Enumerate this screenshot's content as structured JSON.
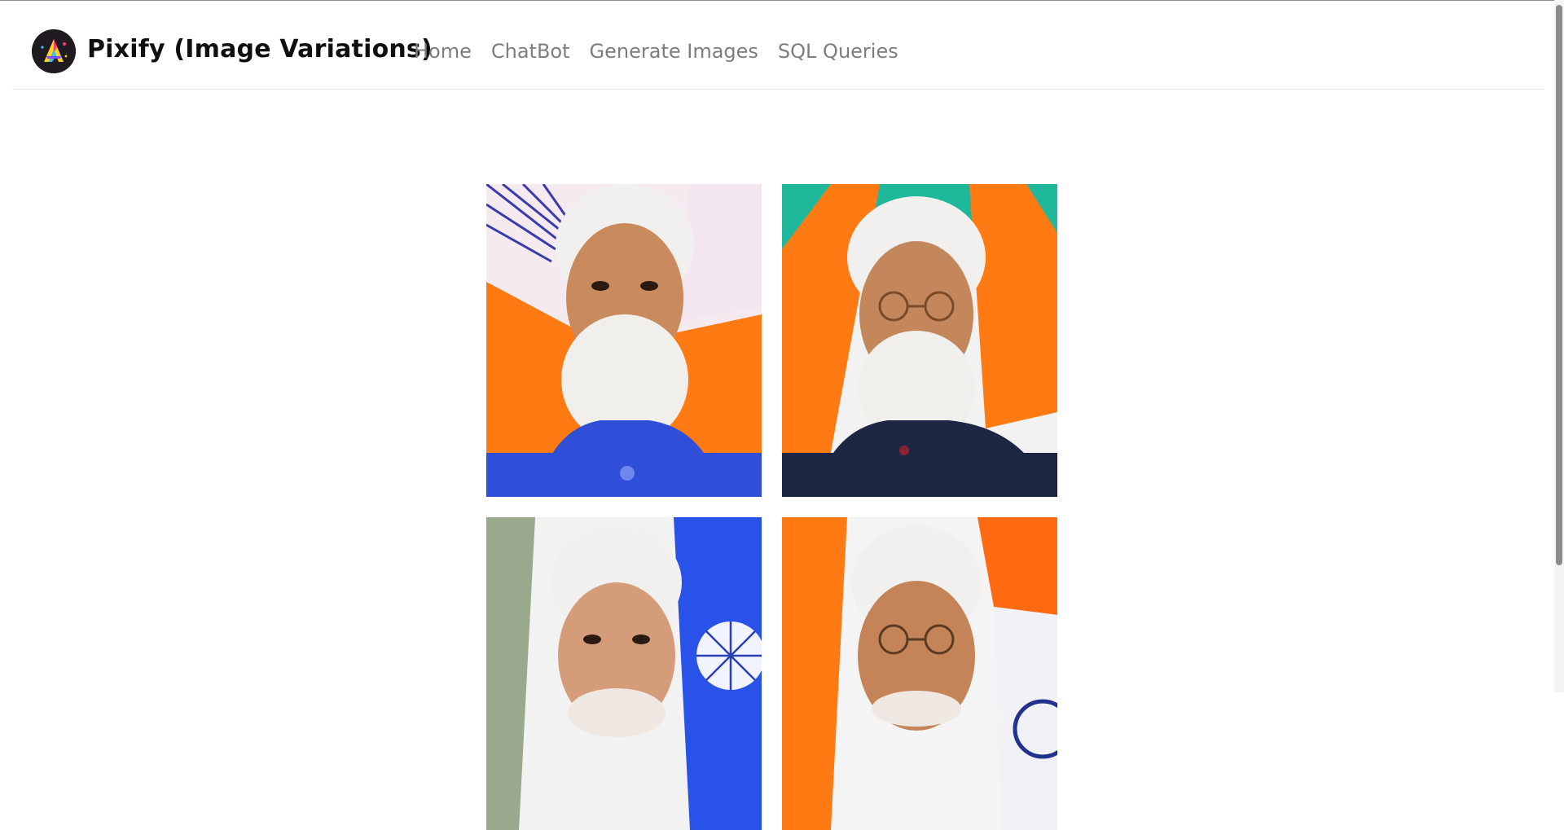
{
  "app": {
    "brand": "Pixify (Image Variations)",
    "logo_icon": "pixify-logo-icon"
  },
  "nav": {
    "links": [
      {
        "label": "Home"
      },
      {
        "label": "ChatBot"
      },
      {
        "label": "Generate Images"
      },
      {
        "label": "SQL Queries"
      }
    ]
  },
  "gallery": {
    "images": [
      {
        "name": "variation-image-1",
        "desc_icon": "portrait-image"
      },
      {
        "name": "variation-image-2",
        "desc_icon": "portrait-image"
      },
      {
        "name": "variation-image-3",
        "desc_icon": "portrait-image"
      },
      {
        "name": "variation-image-4",
        "desc_icon": "portrait-image"
      }
    ]
  },
  "colors": {
    "saffron": "#ff7a12",
    "green": "#1fb89a",
    "blue_jacket": "#2f4fd8",
    "navy_jacket": "#1d2744",
    "beard": "#f1efec",
    "skin": "#c98a5e"
  }
}
